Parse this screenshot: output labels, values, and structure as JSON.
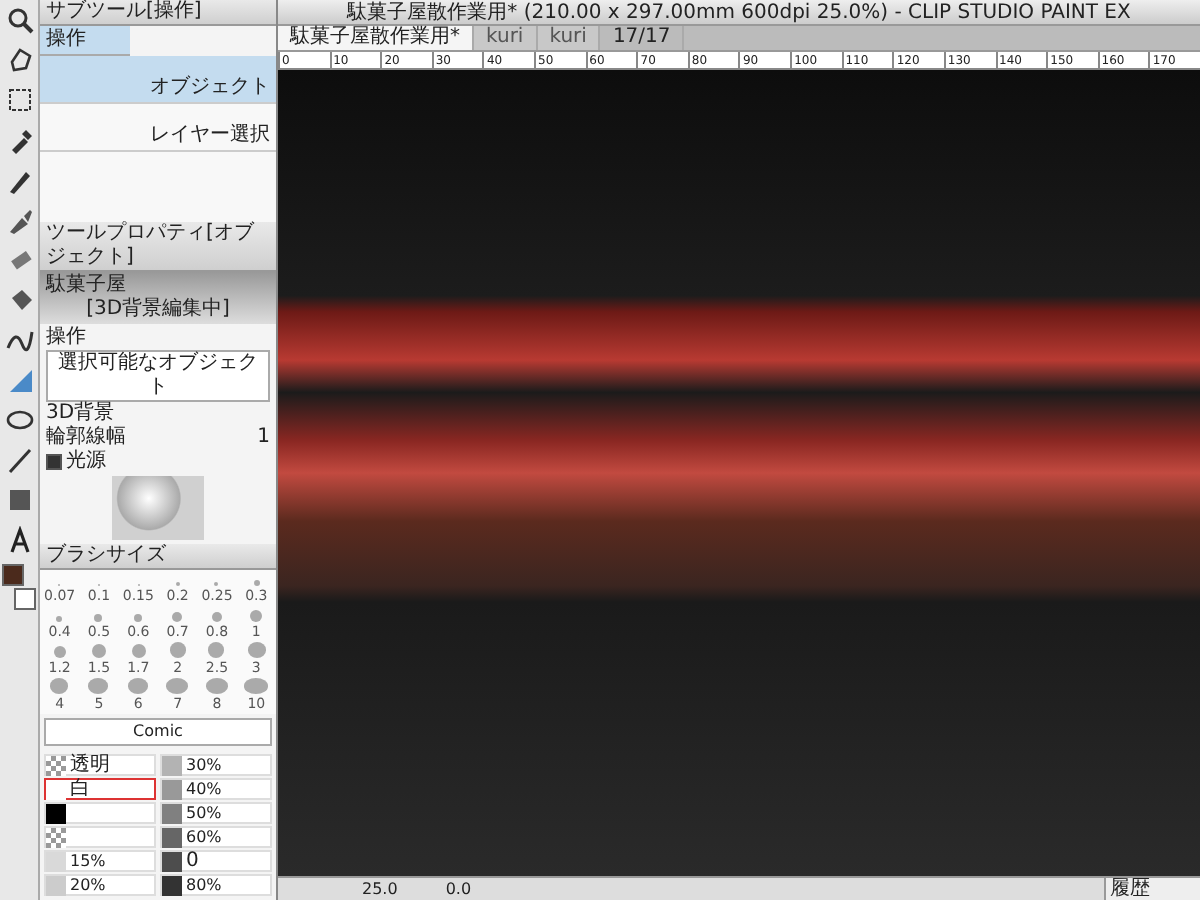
{
  "window": {
    "title": "駄菓子屋散作業用* (210.00 x 297.00mm 600dpi 25.0%) - CLIP STUDIO PAINT EX"
  },
  "document_tabs": [
    {
      "label": "駄菓子屋散作業用*",
      "selected": true
    },
    {
      "label": "kuri",
      "selected": false
    },
    {
      "label": "kuri",
      "selected": false
    }
  ],
  "page_counter": "17/17",
  "ruler_ticks": [
    "0",
    "10",
    "20",
    "30",
    "40",
    "50",
    "60",
    "70",
    "80",
    "90",
    "100",
    "110",
    "120",
    "130",
    "140",
    "150",
    "160",
    "170"
  ],
  "subtool_panel": {
    "tab": "サブツール[操作]",
    "group": "操作",
    "items": [
      {
        "label": "オブジェクト",
        "selected": true
      },
      {
        "label": "レイヤー選択",
        "selected": false
      }
    ]
  },
  "drawing_colors": [
    {
      "kind": "main",
      "color": "#4b2a1c"
    },
    {
      "kind": "sub",
      "color": "#ffffff"
    }
  ],
  "tool_property": {
    "tab": "ツールプロパティ[オブジェクト]",
    "object_name": "駄菓子屋",
    "mode": "[3D背景編集中]",
    "operation_label": "操作",
    "operation_value": "選択可能なオブジェクト",
    "section": "3D背景",
    "outline_label": "輪郭線幅",
    "outline_value": "1",
    "light_label": "光源",
    "light_on": true
  },
  "brush_size": {
    "tab": "ブラシサイズ",
    "sizes": [
      "0.07",
      "0.1",
      "0.15",
      "0.2",
      "0.25",
      "0.3",
      "0.4",
      "0.5",
      "0.6",
      "0.7",
      "0.8",
      "1",
      "1.2",
      "1.5",
      "1.7",
      "2",
      "2.5",
      "3",
      "4",
      "5",
      "6",
      "7",
      "8",
      "10"
    ]
  },
  "color_set": {
    "set_name": "Comic",
    "swatches": [
      {
        "label": "透明",
        "kind": "transparent",
        "selected": false
      },
      {
        "label": "30%",
        "kind": "solid",
        "color": "#b3b3b3",
        "selected": false
      },
      {
        "label": "白",
        "kind": "solid",
        "color": "#ffffff",
        "selected": true
      },
      {
        "label": "40%",
        "kind": "solid",
        "color": "#999999",
        "selected": false
      },
      {
        "kind": "solid",
        "color": "#000000",
        "selected": false
      },
      {
        "label": "50%",
        "kind": "solid",
        "color": "#808080",
        "selected": false
      },
      {
        "kind": "transparent",
        "selected": false
      },
      {
        "label": "60%",
        "kind": "solid",
        "color": "#666666",
        "selected": false
      },
      {
        "label": "15%",
        "kind": "solid",
        "color": "#d9d9d9",
        "selected": false
      },
      {
        "label": "0",
        "kind": "solid",
        "color": "#4d4d4d",
        "selected": false
      },
      {
        "label": "20%",
        "kind": "solid",
        "color": "#cccccc",
        "selected": false
      },
      {
        "label": "80%",
        "kind": "solid",
        "color": "#333333",
        "selected": false
      }
    ]
  },
  "status": {
    "zoom": "25.0",
    "angle": "0.0"
  },
  "history_panel": {
    "label": "履歴"
  }
}
